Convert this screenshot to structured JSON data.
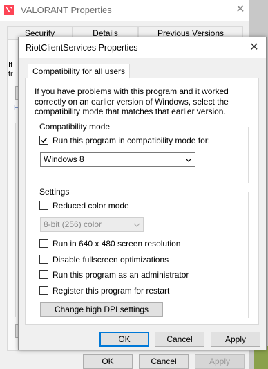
{
  "background_window": {
    "title": "VALORANT Properties",
    "close_glyph": "✕",
    "tabs": [
      "Security",
      "Details",
      "Previous Versions"
    ],
    "buttons": {
      "ok": "OK",
      "cancel": "Cancel",
      "apply": "Apply"
    },
    "fragments": {
      "if": "If",
      "tr": "tr",
      "h": "H"
    }
  },
  "dialog": {
    "title": "RiotClientServices Properties",
    "close_glyph": "✕",
    "tab": "Compatibility for all users",
    "intro": "If you have problems with this program and it worked correctly on an earlier version of Windows, select the compatibility mode that matches that earlier version.",
    "compat_group": {
      "label": "Compatibility mode",
      "checkbox_label": "Run this program in compatibility mode for:",
      "checked": true,
      "selected_os": "Windows 8"
    },
    "settings_group": {
      "label": "Settings",
      "reduced_color": {
        "label": "Reduced color mode",
        "checked": false
      },
      "color_select": "8-bit (256) color",
      "options": [
        {
          "label": "Run in 640 x 480 screen resolution",
          "checked": false
        },
        {
          "label": "Disable fullscreen optimizations",
          "checked": false
        },
        {
          "label": "Run this program as an administrator",
          "checked": false
        },
        {
          "label": "Register this program for restart",
          "checked": false
        }
      ],
      "dpi_button": "Change high DPI settings"
    },
    "buttons": {
      "ok": "OK",
      "cancel": "Cancel",
      "apply": "Apply"
    }
  },
  "icons": {
    "valorant_logo": "valorant-logo-icon",
    "checkmark": "checkmark-icon",
    "dropdown": "chevron-down-icon",
    "close": "close-icon"
  },
  "colors": {
    "accent": "#0078d7",
    "valorant_red": "#fd4556"
  }
}
